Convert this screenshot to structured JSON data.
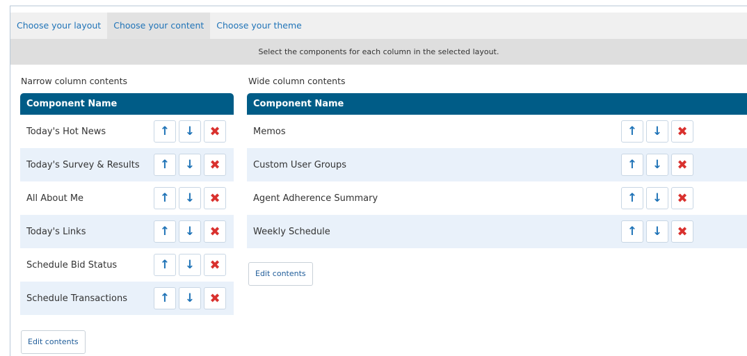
{
  "tabs": [
    {
      "label": "Choose your layout"
    },
    {
      "label": "Choose your content"
    },
    {
      "label": "Choose your theme"
    }
  ],
  "active_tab": "Choose your content",
  "instruction": "Select the components for each column in the selected layout.",
  "narrow": {
    "label": "Narrow column contents",
    "header": "Component Name",
    "items": [
      {
        "label": "Today's Hot News"
      },
      {
        "label": "Today's Survey & Results"
      },
      {
        "label": "All About Me"
      },
      {
        "label": "Today's Links"
      },
      {
        "label": "Schedule Bid Status"
      },
      {
        "label": "Schedule Transactions"
      }
    ],
    "edit_label": "Edit contents"
  },
  "wide": {
    "label": "Wide column contents",
    "header": "Component Name",
    "items": [
      {
        "label": "Memos"
      },
      {
        "label": "Custom User Groups"
      },
      {
        "label": "Agent Adherence Summary"
      },
      {
        "label": "Weekly Schedule"
      }
    ],
    "edit_label": "Edit contents"
  },
  "icons": {
    "up": "↑",
    "down": "↓",
    "remove": "✖"
  },
  "colors": {
    "header_bg": "#005c87",
    "row_alt": "#e9f1fa",
    "link": "#1f73b7",
    "remove": "#d9312e"
  }
}
